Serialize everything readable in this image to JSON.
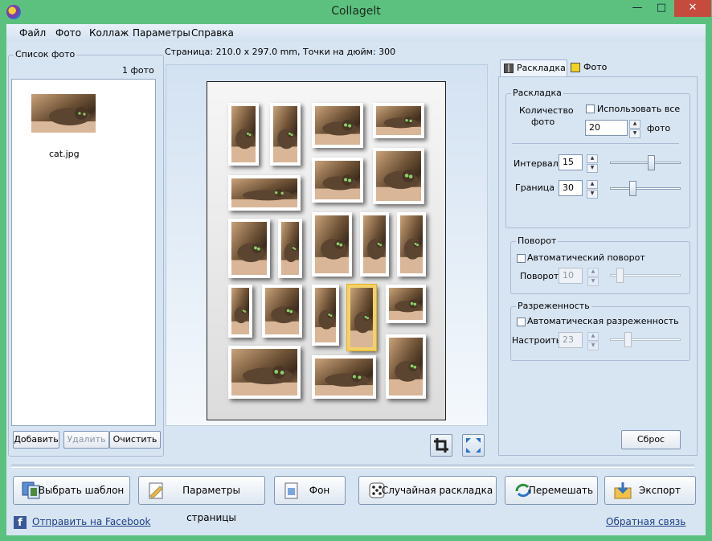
{
  "window": {
    "title": "Collagelt",
    "minimize": "—",
    "maximize": "□",
    "close": "✕"
  },
  "menu": [
    "Файл",
    "Фото",
    "Коллаж",
    "Параметры",
    "Справка"
  ],
  "photo_list": {
    "title": "Список фото",
    "count": "1 фото",
    "items": [
      {
        "filename": "cat.jpg"
      }
    ],
    "add_button": "Добавить",
    "delete_button": "Удалить",
    "clear_button": "Очистить"
  },
  "page_info": "Страница: 210.0 x 297.0 mm, Точки на дюйм: 300",
  "tabs": [
    {
      "label": "Раскладка",
      "icon": "layout-icon",
      "active": true
    },
    {
      "label": "Фото",
      "icon": "photo-icon",
      "active": false
    }
  ],
  "layout_group": {
    "title": "Раскладка",
    "count_label_1": "Количество",
    "count_label_2": "фото",
    "use_all_label": "Использовать все",
    "use_all_checked": false,
    "count_value": "20",
    "count_unit": "фото",
    "interval_label": "Интервал",
    "interval_value": "15",
    "interval_slider_fraction": 0.6,
    "border_label": "Граница",
    "border_value": "30",
    "border_slider_fraction": 0.3
  },
  "rotation_group": {
    "title": "Поворот",
    "auto_label": "Автоматический поворот",
    "auto_checked": false,
    "rotation_label": "Поворот",
    "rotation_value": "10"
  },
  "sparsity_group": {
    "title": "Разреженность",
    "auto_label": "Автоматическая разреженность",
    "auto_checked": false,
    "adjust_label": "Настроить",
    "adjust_value": "23"
  },
  "reset_button": "Сброс",
  "toolbar": {
    "choose_template": "Выбрать шаблон",
    "page_params": "Параметры страницы",
    "background": "Фон",
    "random_layout": "Случайная раскладка",
    "shuffle": "Перемешать",
    "export": "Экспорт"
  },
  "footer": {
    "facebook_link": "Отправить на Facebook",
    "feedback_link": "Обратная связь"
  }
}
